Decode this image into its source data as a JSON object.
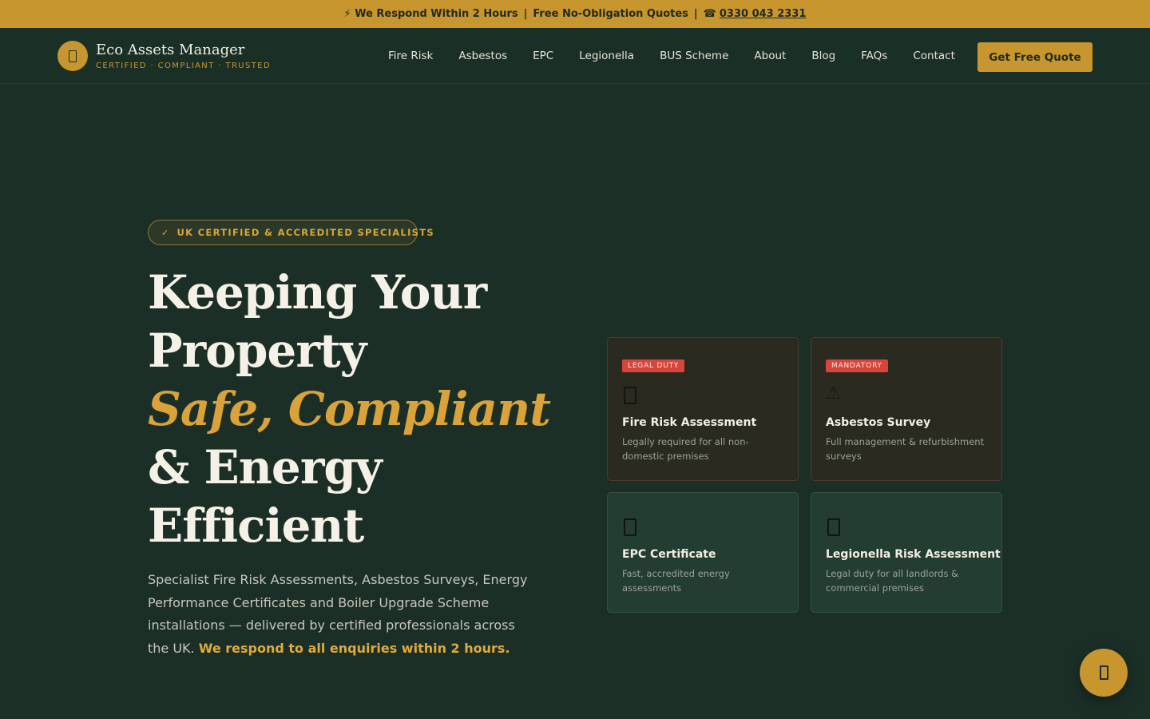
{
  "topbar": {
    "respond": "⚡ We Respond Within 2 Hours",
    "quotes": "Free No-Obligation Quotes",
    "phone_icon": "☎",
    "phone": "0330 043 2331",
    "separator": "|"
  },
  "brand": {
    "name": "Eco Assets Manager",
    "tagline": "CERTIFIED · COMPLIANT · TRUSTED",
    "logo_icon": "shield-icon"
  },
  "nav": {
    "items": [
      "Fire Risk",
      "Asbestos",
      "EPC",
      "Legionella",
      "BUS Scheme",
      "About",
      "Blog",
      "FAQs",
      "Contact"
    ],
    "cta": "Get Free Quote"
  },
  "hero": {
    "badge_check": "✓",
    "badge": "UK CERTIFIED & ACCREDITED SPECIALISTS",
    "headline_1": "Keeping Your",
    "headline_2": "Property",
    "headline_accent": "Safe, Compliant",
    "headline_3": "& Energy",
    "headline_4": "Efficient",
    "lede": "Specialist Fire Risk Assessments, Asbestos Surveys, Energy Performance Certificates and Boiler Upgrade Scheme installations — delivered by certified professionals across the UK.",
    "lede_highlight": "We respond to all enquiries within 2 hours."
  },
  "cards": [
    {
      "tag": "LEGAL DUTY",
      "icon": "fire-icon",
      "title": "Fire Risk Assessment",
      "desc": "Legally required for all non-domestic premises"
    },
    {
      "tag": "MANDATORY",
      "icon": "warning-icon",
      "icon_glyph": "⚠",
      "title": "Asbestos Survey",
      "desc": "Full management & refurbishment surveys"
    },
    {
      "tag": "",
      "icon": "energy-icon",
      "title": "EPC Certificate",
      "desc": "Fast, accredited energy assessments"
    },
    {
      "tag": "",
      "icon": "water-icon",
      "title": "Legionella Risk Assessment",
      "desc": "Legal duty for all landlords & commercial premises"
    }
  ],
  "colors": {
    "gold": "#c8962e",
    "background": "#1b2f27",
    "tag_red": "#d8453b"
  },
  "fab": {
    "icon": "chat-icon"
  }
}
